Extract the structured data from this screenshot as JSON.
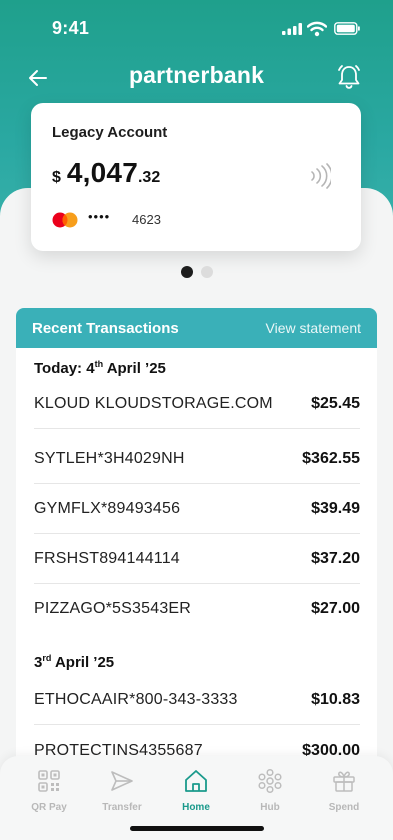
{
  "status_bar": {
    "time": "9:41"
  },
  "header": {
    "brand": "partnerbank"
  },
  "account_card": {
    "title": "Legacy Account",
    "currency": "$",
    "balance_whole": "4,047",
    "balance_cents": ".32",
    "card_mask": "••••",
    "card_last4": "4623"
  },
  "pager": {
    "pages": 2,
    "active_index": 0
  },
  "transactions": {
    "heading": "Recent Transactions",
    "view_statement": "View statement",
    "groups": [
      {
        "day_prefix": "Today: 4",
        "day_sup": "th",
        "day_suffix": " April ’25",
        "items": [
          {
            "merchant": "KLOUD KLOUDSTORAGE.COM",
            "amount": "$25.45"
          },
          {
            "merchant": "SYTLEH*3H4029NH",
            "amount": "$362.55"
          },
          {
            "merchant": "GYMFLX*89493456",
            "amount": "$39.49"
          },
          {
            "merchant": "FRSHST894144114",
            "amount": "$37.20"
          },
          {
            "merchant": "PIZZAGO*5S3543ER",
            "amount": "$27.00"
          }
        ]
      },
      {
        "day_prefix": "3",
        "day_sup": "rd",
        "day_suffix": " April ’25",
        "items": [
          {
            "merchant": "ETHOCAAIR*800-343-3333",
            "amount": "$10.83"
          },
          {
            "merchant": "PROTECTINS4355687",
            "amount": "$300.00"
          }
        ]
      }
    ]
  },
  "tabbar": {
    "tabs": [
      {
        "label": "QR Pay",
        "icon": "qr-code-icon"
      },
      {
        "label": "Transfer",
        "icon": "paper-plane-icon"
      },
      {
        "label": "Home",
        "icon": "home-icon",
        "active": true
      },
      {
        "label": "Hub",
        "icon": "hub-icon"
      },
      {
        "label": "Spend",
        "icon": "gift-icon"
      }
    ]
  },
  "colors": {
    "accent": "#1fa08c",
    "header_bar": "#3ab0b8",
    "active_tab": "#1a9a8c",
    "inactive_tab": "#b8b8b8"
  }
}
